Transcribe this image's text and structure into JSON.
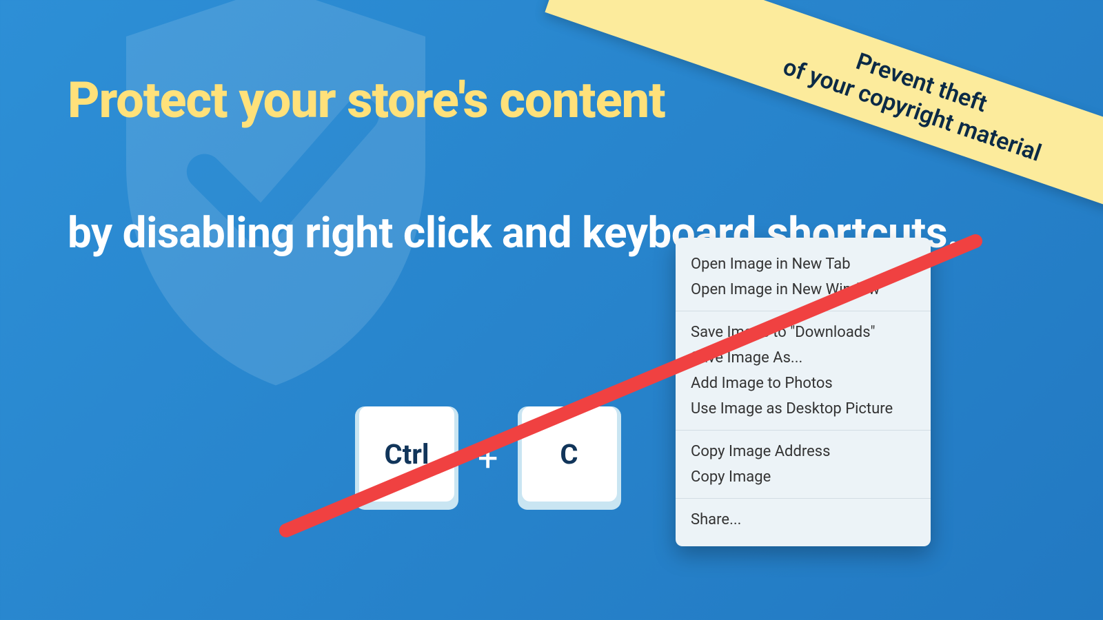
{
  "headline": "Protect your store's content",
  "subhead": "by disabling right click and keyboard shortcuts.",
  "ribbon": {
    "line1": "Prevent theft",
    "line2": "of your copyright material"
  },
  "keys": {
    "ctrl": "Ctrl",
    "plus": "+",
    "c": "C"
  },
  "context_menu": {
    "group1": [
      "Open Image in New Tab",
      "Open Image in New Window"
    ],
    "group2": [
      "Save Image to \"Downloads\"",
      "Save Image As...",
      "Add Image to Photos",
      "Use Image as Desktop Picture"
    ],
    "group3": [
      "Copy Image Address",
      "Copy Image"
    ],
    "group4": [
      "Share..."
    ]
  },
  "colors": {
    "bg_start": "#2d8fd6",
    "bg_end": "#2279c2",
    "accent_yellow": "#ffe17a",
    "ribbon_bg": "#fceb9c",
    "text_white": "#ffffff",
    "key_text": "#11355a",
    "strike_red": "#f04141"
  }
}
